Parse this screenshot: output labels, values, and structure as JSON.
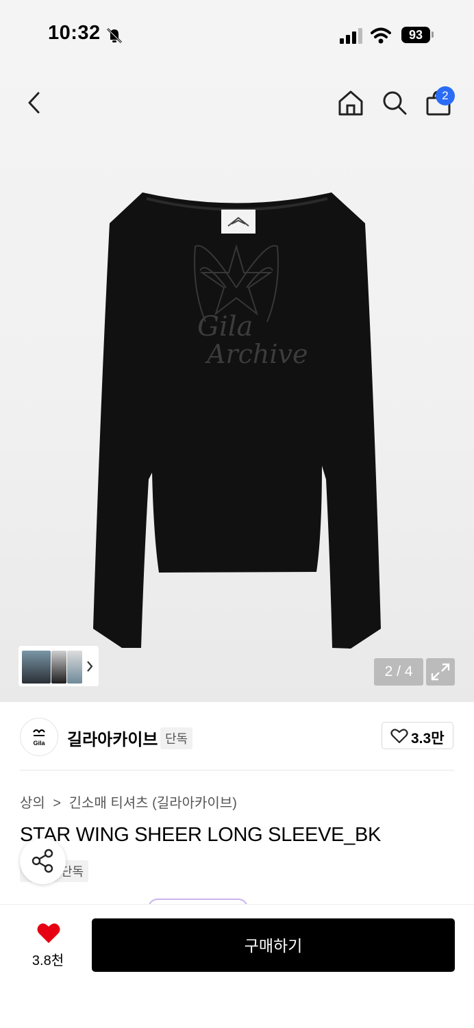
{
  "status_bar": {
    "time": "10:32",
    "battery": "93"
  },
  "header": {
    "cart_count": "2"
  },
  "gallery": {
    "page_indicator": "2 / 4",
    "print_text_1": "Gila",
    "print_text_2": "Archive"
  },
  "brand": {
    "logo_text": "Gila",
    "name": "길라아카이브",
    "exclusive_badge": "단독",
    "likes": "3.3만"
  },
  "product": {
    "breadcrumb": {
      "root": "상의",
      "separator": ">",
      "category": "긴소매 티셔츠 (길라아카이브)"
    },
    "title": "STAR WING SHEER LONG SLEEVE_BK",
    "tag": "단독"
  },
  "bottom_bar": {
    "wish_count": "3.8천",
    "buy_label": "구매하기"
  },
  "colors": {
    "accent_blue": "#2a6cf5",
    "heart_red": "#e60012",
    "buy_button": "#000000"
  }
}
